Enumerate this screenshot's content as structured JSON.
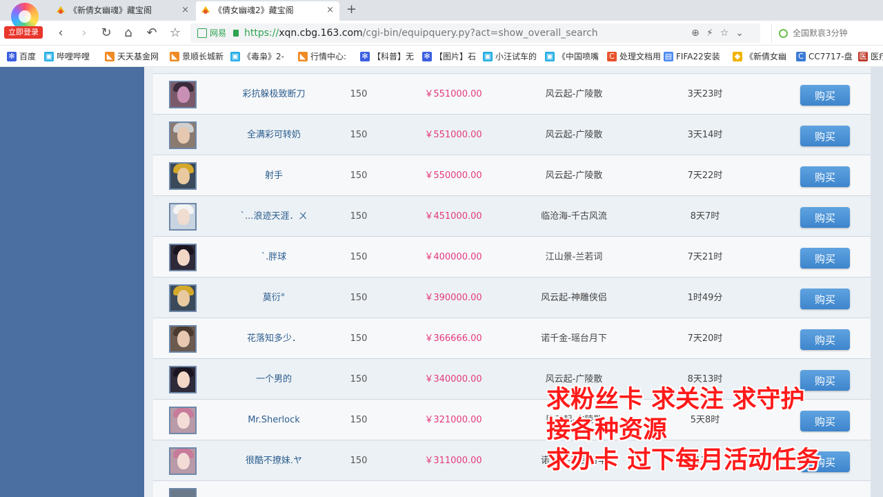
{
  "browser": {
    "login_badge": "立即登录",
    "tabs": [
      {
        "title": "《新倩女幽魂》藏宝阁",
        "close": "×"
      },
      {
        "title": "《倩女幽魂2》藏宝阁",
        "close": "×"
      }
    ],
    "new_tab": "+",
    "address": {
      "site_label": "网易",
      "scheme": "https://",
      "host": "xqn.cbg.163.com",
      "path": "/cgi-bin/equipquery.py?act=show_overall_search"
    },
    "search_text": "全国默哀3分钟",
    "bookmarks": [
      {
        "label": "百度",
        "icon": "baidu-paw-icon",
        "color": "#3b5fe0"
      },
      {
        "label": "哔哩哔哩",
        "icon": "bilibili-icon",
        "color": "#23ade5"
      },
      {
        "label": "天天基金网",
        "icon": "fund-icon",
        "color": "#f08a24"
      },
      {
        "label": "景顺长城新",
        "icon": "fund-icon",
        "color": "#f08a24"
      },
      {
        "label": "《毒枭》2-",
        "icon": "bilibili-icon",
        "color": "#23ade5"
      },
      {
        "label": "行情中心:",
        "icon": "fund-icon",
        "color": "#f08a24"
      },
      {
        "label": "【科普】无",
        "icon": "baidu-paw-icon",
        "color": "#3b5fe0"
      },
      {
        "label": "【图片】石",
        "icon": "baidu-paw-icon",
        "color": "#3b5fe0"
      },
      {
        "label": "小汪试车的",
        "icon": "bilibili-icon",
        "color": "#23ade5"
      },
      {
        "label": "《中国喷嘴",
        "icon": "bilibili-icon",
        "color": "#23ade5"
      },
      {
        "label": "处理文档用",
        "icon": "c-icon",
        "color": "#e8532b"
      },
      {
        "label": "FIFA22安装",
        "icon": "doc-icon",
        "color": "#4a8af4"
      },
      {
        "label": "《新倩女幽",
        "icon": "game-icon",
        "color": "#f0b400"
      },
      {
        "label": "CC7717-盘",
        "icon": "cc-icon",
        "color": "#3a7bd5"
      },
      {
        "label": "医疗",
        "icon": "med-icon",
        "color": "#c0392b"
      }
    ]
  },
  "listing": {
    "buy_label": "购买",
    "rows": [
      {
        "name": "彩抗躲极致断刀",
        "level": "150",
        "price": "￥551000.00",
        "server": "风云起-广陵散",
        "time": "3天23时",
        "avatar": "purple-mask"
      },
      {
        "name": "全满彩可转奶",
        "level": "150",
        "price": "￥551000.00",
        "server": "风云起-广陵散",
        "time": "3天14时",
        "avatar": "silver-hair"
      },
      {
        "name": "射手",
        "level": "150",
        "price": "￥550000.00",
        "server": "风云起-广陵散",
        "time": "7天22时",
        "avatar": "gold-helmet"
      },
      {
        "name": "`...浪迹天涯．ㄨ",
        "level": "150",
        "price": "￥451000.00",
        "server": "临沧海-千古风流",
        "time": "8天7时",
        "avatar": "white-hair"
      },
      {
        "name": "`.胖球",
        "level": "150",
        "price": "￥400000.00",
        "server": "江山景-兰若词",
        "time": "7天21时",
        "avatar": "dark-hair-female"
      },
      {
        "name": "莫衍°",
        "level": "150",
        "price": "￥390000.00",
        "server": "风云起-神雕侠侣",
        "time": "1时49分",
        "avatar": "gold-helmet"
      },
      {
        "name": "花落知多少．",
        "level": "150",
        "price": "￥366666.00",
        "server": "诺千金-瑶台月下",
        "time": "7天20时",
        "avatar": "long-hair-male"
      },
      {
        "name": "一个男的",
        "level": "150",
        "price": "￥340000.00",
        "server": "风云起-广陵散",
        "time": "8天13时",
        "avatar": "dark-hair-female"
      },
      {
        "name": "Mr.Sherlock",
        "level": "150",
        "price": "￥321000.00",
        "server": "风云起-广陵散",
        "time": "5天8时",
        "avatar": "pink-hair-female"
      },
      {
        "name": "很酷不撩妹.ヤ",
        "level": "150",
        "price": "￥311000.00",
        "server": "诺千金-瑶台月华",
        "time": "13天",
        "avatar": "pink-hair-female"
      }
    ]
  },
  "overlay": {
    "line1": "求粉丝卡  求关注  求守护",
    "line2": "接各种资源",
    "line3": "求办卡 过下每月活动任务"
  }
}
